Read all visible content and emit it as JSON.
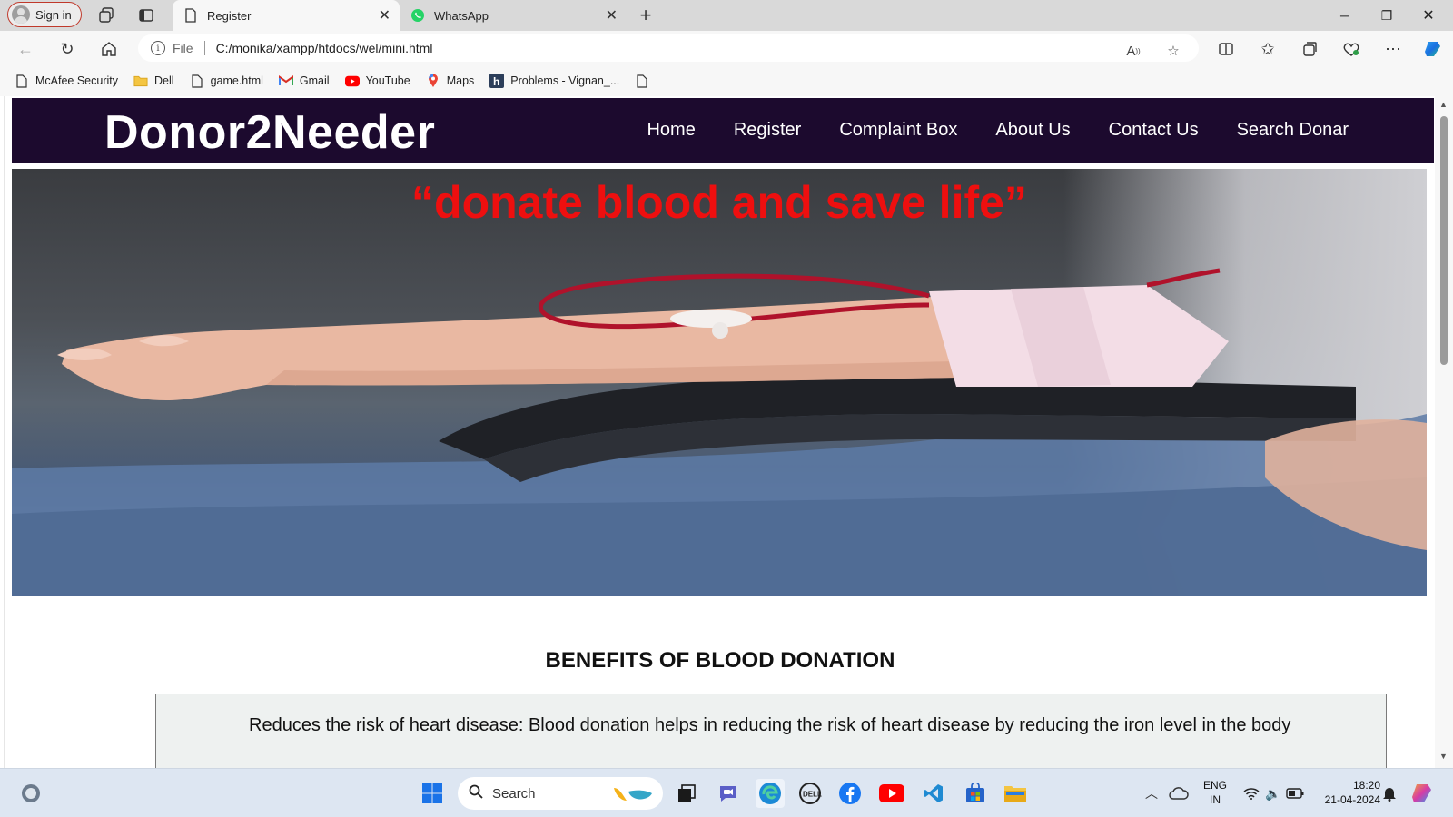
{
  "browser": {
    "signin_label": "Sign in",
    "tabs": [
      {
        "title": "Register",
        "active": true,
        "icon": "page-icon"
      },
      {
        "title": "WhatsApp",
        "active": false,
        "icon": "whatsapp-icon"
      }
    ],
    "new_tab_glyph": "+",
    "address": {
      "scheme_label": "File",
      "url": "C:/monika/xampp/htdocs/wel/mini.html"
    },
    "bookmarks": [
      {
        "label": "McAfee Security",
        "icon": "page-icon"
      },
      {
        "label": "Dell",
        "icon": "folder-icon"
      },
      {
        "label": "game.html",
        "icon": "page-icon"
      },
      {
        "label": "Gmail",
        "icon": "gmail-icon"
      },
      {
        "label": "YouTube",
        "icon": "youtube-icon"
      },
      {
        "label": "Maps",
        "icon": "maps-icon"
      },
      {
        "label": "Problems - Vignan_...",
        "icon": "h-icon"
      }
    ]
  },
  "site": {
    "brand": "Donor2Needer",
    "nav": [
      "Home",
      "Register",
      "Complaint Box",
      "About Us",
      "Contact Us",
      "Search Donar"
    ],
    "slogan": "“donate blood and save life”",
    "benefits_title": "BENEFITS OF BLOOD DONATION",
    "benefits": [
      "Reduces the risk of heart disease: Blood donation helps in reducing the risk of heart disease by reducing the iron level in the body"
    ],
    "colors": {
      "header_bg": "#1c0a2e",
      "slogan": "#ee0f0f",
      "box_bg": "#eef1f0"
    }
  },
  "taskbar": {
    "search_placeholder": "Search",
    "language": {
      "line1": "ENG",
      "line2": "IN"
    },
    "clock": {
      "time": "18:20",
      "date": "21-04-2024"
    }
  }
}
